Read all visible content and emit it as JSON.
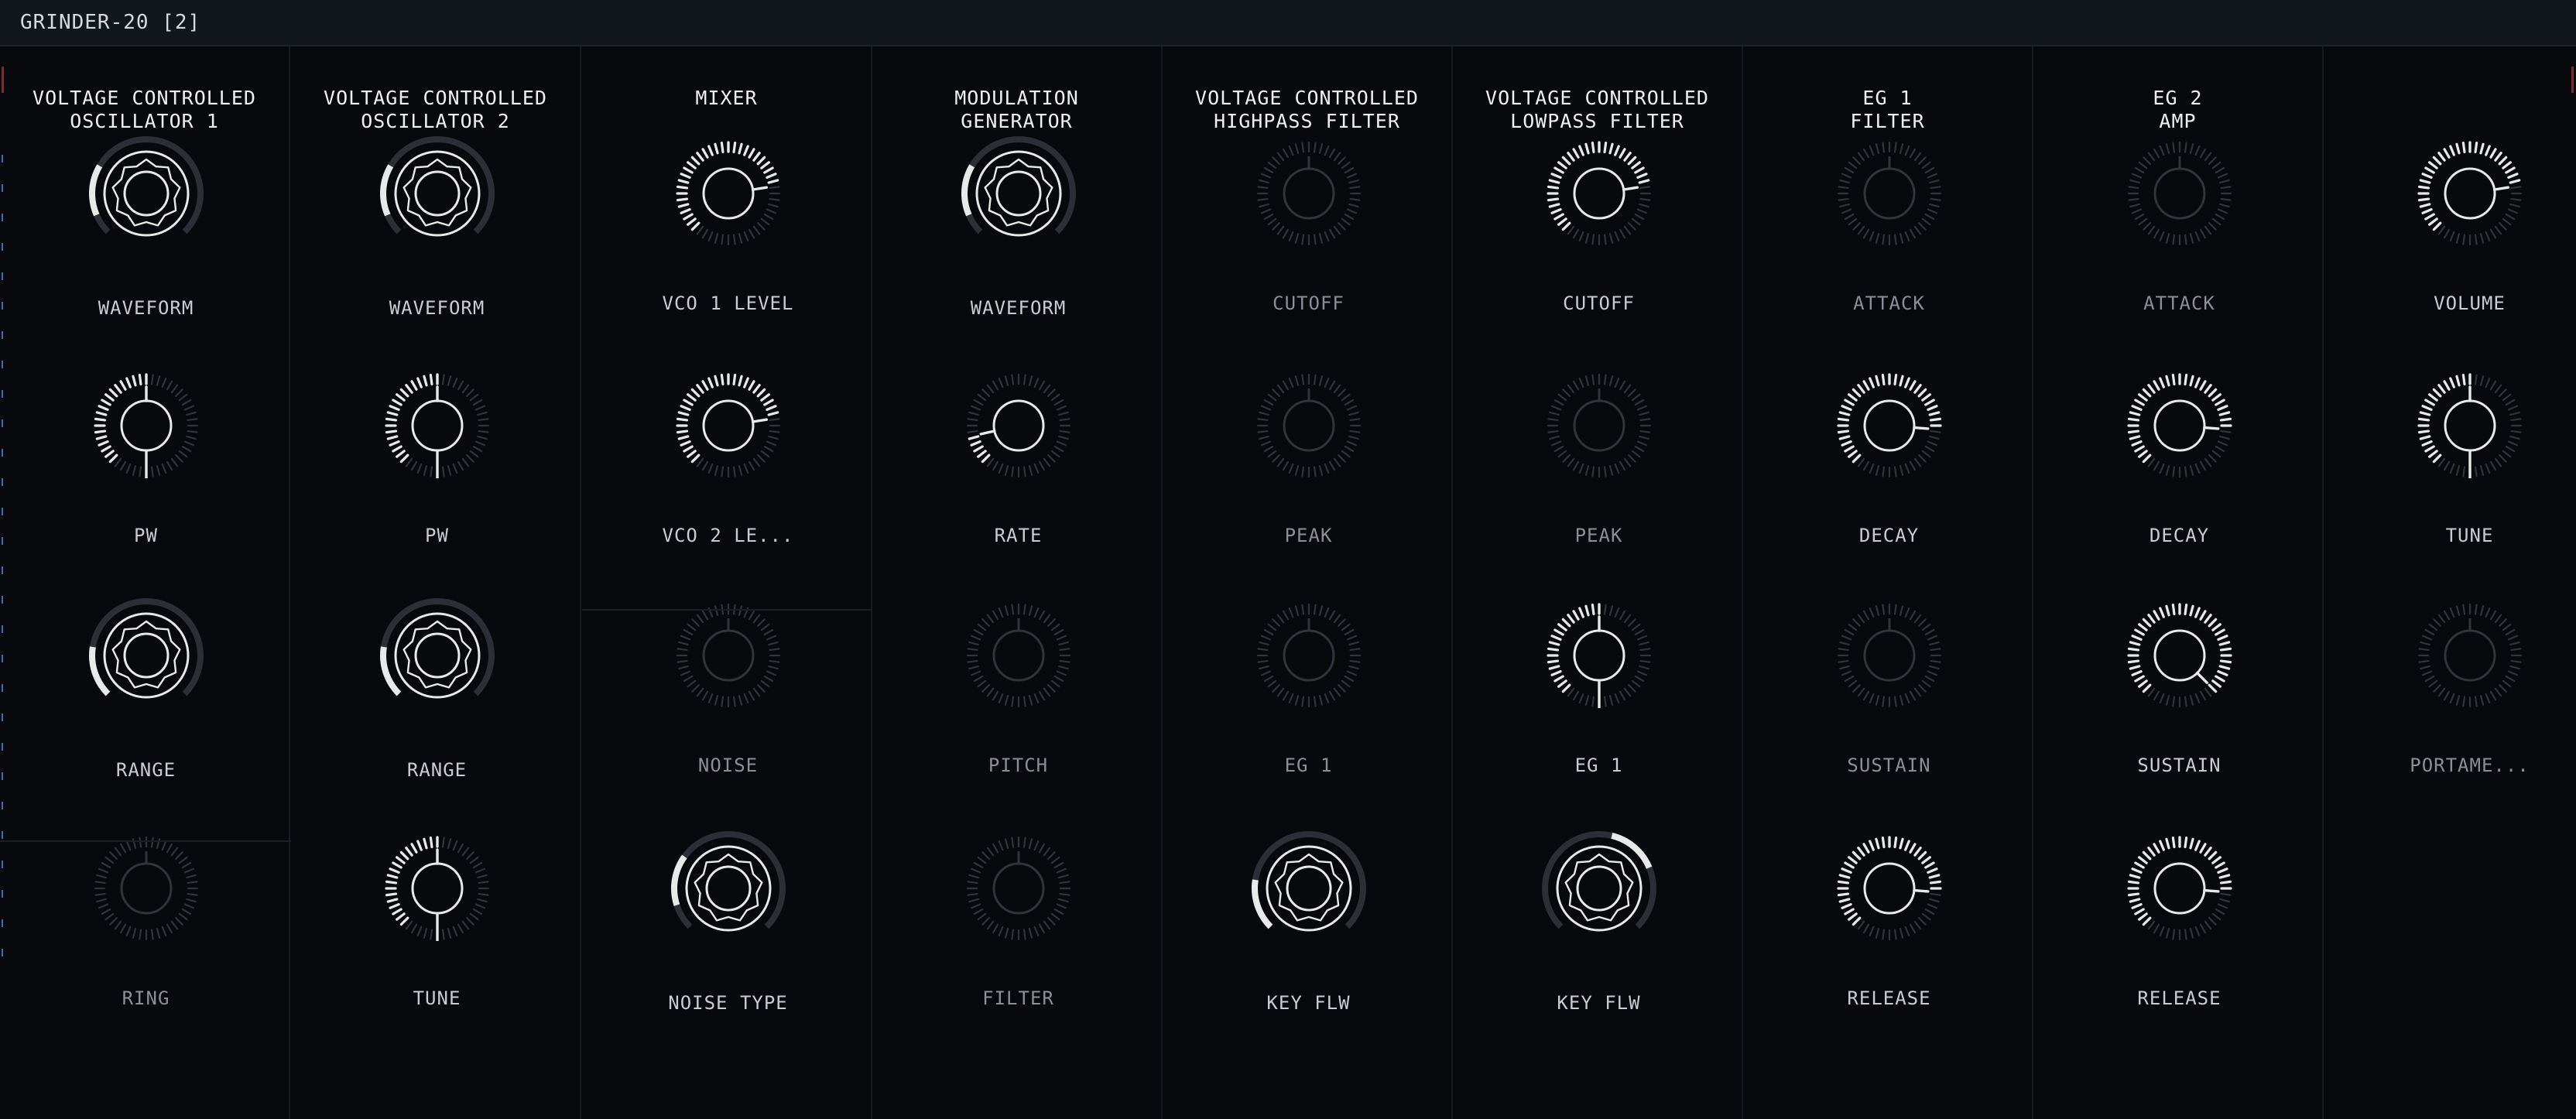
{
  "window": {
    "title": "GRINDER-20 [2]"
  },
  "colors": {
    "accent": "#e9e9e9",
    "inactive": "#30343b",
    "background": "#07090d",
    "marker": "#3a6fb5"
  },
  "columns": [
    {
      "id": "vco1",
      "title_lines": [
        "VOLTAGE CONTROLLED",
        "OSCILLATOR 1"
      ],
      "knobs": [
        {
          "label": "WAVEFORM",
          "type": "selector",
          "value": 0.28,
          "active": true
        },
        {
          "label": "PW",
          "type": "bipolar",
          "value": 0.5,
          "active": true
        },
        {
          "label": "RANGE",
          "type": "selector",
          "value": 0.2,
          "active": true
        },
        {
          "label": "RING",
          "type": "dial",
          "value": 0,
          "active": false
        }
      ]
    },
    {
      "id": "vco2",
      "title_lines": [
        "VOLTAGE CONTROLLED",
        "OSCILLATOR 2"
      ],
      "knobs": [
        {
          "label": "WAVEFORM",
          "type": "selector",
          "value": 0.28,
          "active": true
        },
        {
          "label": "PW",
          "type": "bipolar",
          "value": 0.5,
          "active": true
        },
        {
          "label": "RANGE",
          "type": "selector",
          "value": 0.2,
          "active": true
        },
        {
          "label": "TUNE",
          "type": "bipolar",
          "value": 0.5,
          "active": true
        }
      ]
    },
    {
      "id": "mixer",
      "title_lines": [
        "MIXER"
      ],
      "knobs": [
        {
          "label": "VCO 1 LEVEL",
          "type": "dial",
          "value": 0.8,
          "active": true
        },
        {
          "label": "VCO 2 LE...",
          "type": "dial",
          "value": 0.8,
          "active": true
        },
        {
          "label": "NOISE",
          "type": "dial",
          "value": 0,
          "active": false
        },
        {
          "label": "NOISE TYPE",
          "type": "selector",
          "value": 0.3,
          "active": true
        }
      ]
    },
    {
      "id": "modgen",
      "title_lines": [
        "MODULATION",
        "GENERATOR"
      ],
      "knobs": [
        {
          "label": "WAVEFORM",
          "type": "selector",
          "value": 0.28,
          "active": true
        },
        {
          "label": "RATE",
          "type": "dial",
          "value": 0.12,
          "active": true
        },
        {
          "label": "PITCH",
          "type": "dial",
          "value": 0,
          "active": false
        },
        {
          "label": "FILTER",
          "type": "dial",
          "value": 0,
          "active": false
        }
      ]
    },
    {
      "id": "hpf",
      "title_lines": [
        "VOLTAGE CONTROLLED",
        "HIGHPASS FILTER"
      ],
      "knobs": [
        {
          "label": "CUTOFF",
          "type": "dial",
          "value": 0,
          "active": false
        },
        {
          "label": "PEAK",
          "type": "dial",
          "value": 0,
          "active": false
        },
        {
          "label": "EG 1",
          "type": "dial",
          "value": 0,
          "active": false
        },
        {
          "label": "KEY FLW",
          "type": "selector",
          "value": 0.2,
          "active": true
        }
      ]
    },
    {
      "id": "lpf",
      "title_lines": [
        "VOLTAGE CONTROLLED",
        "LOWPASS FILTER"
      ],
      "knobs": [
        {
          "label": "CUTOFF",
          "type": "dial",
          "value": 0.8,
          "active": true
        },
        {
          "label": "PEAK",
          "type": "dial",
          "value": 0,
          "active": false
        },
        {
          "label": "EG 1",
          "type": "bipolar",
          "value": 0.5,
          "active": true
        },
        {
          "label": "KEY FLW",
          "type": "selector",
          "value": 0.75,
          "active": true
        }
      ]
    },
    {
      "id": "eg1",
      "title_lines": [
        "EG 1",
        "FILTER"
      ],
      "knobs": [
        {
          "label": "ATTACK",
          "type": "dial",
          "value": 0,
          "active": false
        },
        {
          "label": "DECAY",
          "type": "dial",
          "value": 0.85,
          "active": true
        },
        {
          "label": "SUSTAIN",
          "type": "dial",
          "value": 0,
          "active": false
        },
        {
          "label": "RELEASE",
          "type": "dial",
          "value": 0.85,
          "active": true
        }
      ]
    },
    {
      "id": "eg2",
      "title_lines": [
        "EG 2",
        "AMP"
      ],
      "knobs": [
        {
          "label": "ATTACK",
          "type": "dial",
          "value": 0,
          "active": false
        },
        {
          "label": "DECAY",
          "type": "dial",
          "value": 0.85,
          "active": true
        },
        {
          "label": "SUSTAIN",
          "type": "dial",
          "value": 1.0,
          "active": true
        },
        {
          "label": "RELEASE",
          "type": "dial",
          "value": 0.85,
          "active": true
        }
      ]
    },
    {
      "id": "master",
      "title_lines": [],
      "knobs": [
        {
          "label": "VOLUME",
          "type": "dial",
          "value": 0.8,
          "active": true
        },
        {
          "label": "TUNE",
          "type": "bipolar",
          "value": 0.5,
          "active": true
        },
        {
          "label": "PORTAME...",
          "type": "dial",
          "value": 0,
          "active": false
        }
      ]
    }
  ]
}
